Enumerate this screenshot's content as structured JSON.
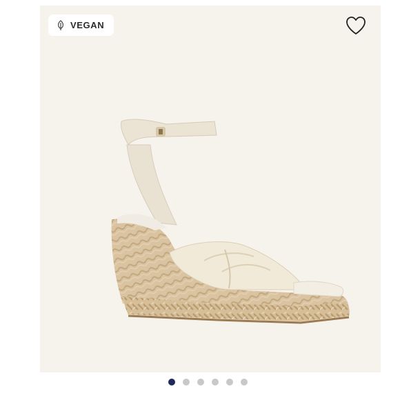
{
  "badge": {
    "label": "VEGAN",
    "icon": "leaf-icon"
  },
  "favorite": {
    "icon": "heart-icon"
  },
  "product_image": {
    "subject": "sandal-image"
  },
  "carousel": {
    "dot_count": 6,
    "active_index": 0,
    "active_color": "#1f2a5c",
    "inactive_color": "#c8c8c8"
  },
  "colors": {
    "card_background": "#f6f2ec"
  }
}
